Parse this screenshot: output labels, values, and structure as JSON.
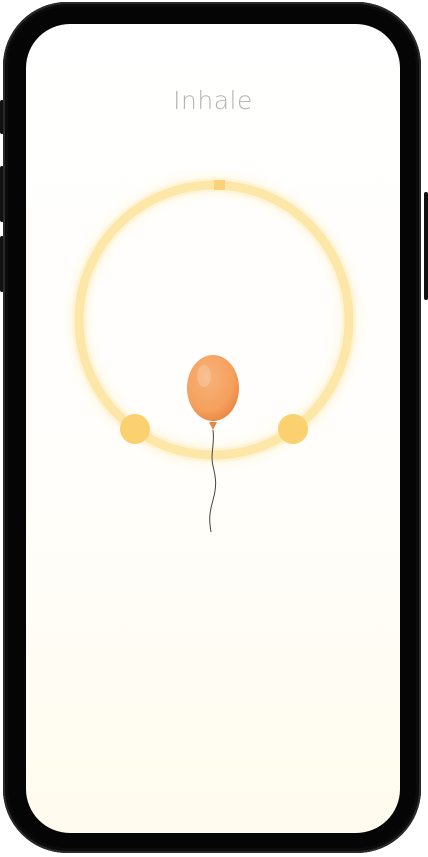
{
  "screen": {
    "phase_label": "Inhale"
  },
  "exercise": {
    "ring_color": "#fde7a8",
    "ring_marker_color": "#fbd27a",
    "knob_color": "#fbd06f",
    "balloon_color": "#f5a05c",
    "balloon_shade_color": "#e88544",
    "string_color": "#444444"
  }
}
